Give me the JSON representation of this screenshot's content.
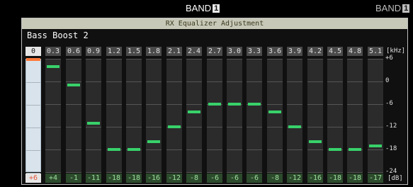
{
  "header": {
    "band_label": "BAND",
    "band_number": "1",
    "band_label_right": "BAND",
    "band_number_right": "1"
  },
  "panel": {
    "title": "RX Equalizer Adjustment",
    "preset_name": "Bass Boost 2"
  },
  "units": {
    "frequency": "[kHz]",
    "gain": "[dB]"
  },
  "scale_labels": [
    "+6",
    "0",
    "-6",
    "-12",
    "-18",
    "-24"
  ],
  "scale_values": [
    6,
    0,
    -6,
    -12,
    -18,
    -24
  ],
  "range": {
    "max": 6,
    "min": -24
  },
  "bands": [
    {
      "freq": "0",
      "label": "+6",
      "gain": 6,
      "selected": true
    },
    {
      "freq": "0.3",
      "label": "+4",
      "gain": 4
    },
    {
      "freq": "0.6",
      "label": "-1",
      "gain": -1
    },
    {
      "freq": "0.9",
      "label": "-11",
      "gain": -11
    },
    {
      "freq": "1.2",
      "label": "-18",
      "gain": -18
    },
    {
      "freq": "1.5",
      "label": "-18",
      "gain": -18
    },
    {
      "freq": "1.8",
      "label": "-16",
      "gain": -16
    },
    {
      "freq": "2.1",
      "label": "-12",
      "gain": -12
    },
    {
      "freq": "2.4",
      "label": "-8",
      "gain": -8
    },
    {
      "freq": "2.7",
      "label": "-6",
      "gain": -6
    },
    {
      "freq": "3.0",
      "label": "-6",
      "gain": -6
    },
    {
      "freq": "3.3",
      "label": "-6",
      "gain": -6
    },
    {
      "freq": "3.6",
      "label": "-8",
      "gain": -8
    },
    {
      "freq": "3.9",
      "label": "-12",
      "gain": -12
    },
    {
      "freq": "4.2",
      "label": "-16",
      "gain": -16
    },
    {
      "freq": "4.5",
      "label": "-18",
      "gain": -18
    },
    {
      "freq": "4.8",
      "label": "-18",
      "gain": -18
    },
    {
      "freq": "5.1",
      "label": "-17",
      "gain": -17
    }
  ],
  "colors": {
    "marker": "#38d16a",
    "marker_selected": "#ff7a3a",
    "title_bar": "#c8c8b8"
  }
}
